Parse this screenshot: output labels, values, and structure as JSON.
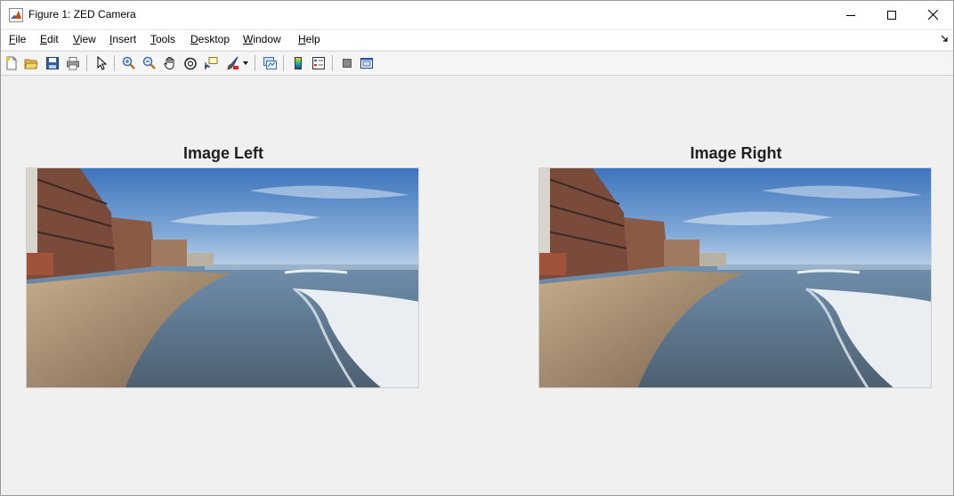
{
  "window": {
    "title": "Figure 1: ZED Camera",
    "icon": "matlab-logo-icon"
  },
  "menubar": {
    "items": [
      {
        "label": "File",
        "mnemonic": "F"
      },
      {
        "label": "Edit",
        "mnemonic": "E"
      },
      {
        "label": "View",
        "mnemonic": "V"
      },
      {
        "label": "Insert",
        "mnemonic": "I"
      },
      {
        "label": "Tools",
        "mnemonic": "T"
      },
      {
        "label": "Desktop",
        "mnemonic": "D"
      },
      {
        "label": "Window",
        "mnemonic": "W"
      },
      {
        "label": "Help",
        "mnemonic": "H"
      }
    ]
  },
  "toolbar": {
    "buttons": [
      "new-figure-icon",
      "open-file-icon",
      "save-icon",
      "print-icon",
      "select-arrow-icon",
      "zoom-in-icon",
      "zoom-out-icon",
      "pan-hand-icon",
      "rotate-3d-icon",
      "data-cursor-icon",
      "brush-icon",
      "brush-dropdown-icon",
      "link-plot-icon",
      "insert-colorbar-icon",
      "insert-legend-icon",
      "hide-plot-tools-icon",
      "show-plot-tools-icon"
    ]
  },
  "figure": {
    "axes": [
      {
        "title": "Image Left",
        "image": "beach-scene-left"
      },
      {
        "title": "Image Right",
        "image": "beach-scene-right"
      }
    ]
  },
  "colors": {
    "window_bg": "#f0f0f0",
    "titlebar_bg": "#ffffff",
    "sky": "#4f84c4",
    "sand": "#b89a7a",
    "water": "#5d7d94"
  }
}
